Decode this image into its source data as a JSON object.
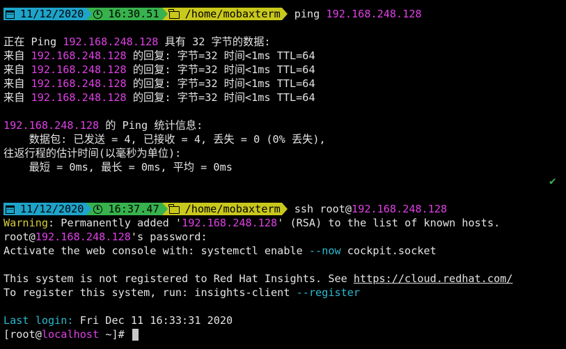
{
  "prompt1": {
    "date": "11/12/2020",
    "time": "16:30.51",
    "path": "/home/mobaxterm",
    "command": "ping ",
    "target": "192.168.248.128"
  },
  "ping": {
    "header_pre": "正在 Ping ",
    "header_ip": "192.168.248.128",
    "header_post": " 具有 32 字节的数据:",
    "replies": [
      {
        "pre": "来自 ",
        "ip": "192.168.248.128",
        "post": " 的回复: 字节=32 时间<1ms TTL=64"
      },
      {
        "pre": "来自 ",
        "ip": "192.168.248.128",
        "post": " 的回复: 字节=32 时间<1ms TTL=64"
      },
      {
        "pre": "来自 ",
        "ip": "192.168.248.128",
        "post": " 的回复: 字节=32 时间<1ms TTL=64"
      },
      {
        "pre": "来自 ",
        "ip": "192.168.248.128",
        "post": " 的回复: 字节=32 时间<1ms TTL=64"
      }
    ],
    "stats_ip": "192.168.248.128",
    "stats_title": " 的 Ping 统计信息:",
    "packets": "    数据包: 已发送 = 4, 已接收 = 4, 丢失 = 0 (0% 丢失),",
    "rtt_title": "往返行程的估计时间(以毫秒为单位):",
    "rtt": "    最短 = 0ms, 最长 = 0ms, 平均 = 0ms"
  },
  "prompt2": {
    "date": "11/12/2020",
    "time": "16:37.47",
    "path": "/home/mobaxterm",
    "command": "ssh root@",
    "target": "192.168.248.128"
  },
  "ssh": {
    "warning_label": "Warning",
    "warning_pre": ": Permanently added '",
    "warning_ip": "192.168.248.128",
    "warning_post": "' (RSA) to the list of known hosts.",
    "pw_user": "root@",
    "pw_ip": "192.168.248.128",
    "pw_post": "'s password:",
    "activate_pre": "Activate the web console with: systemctl enable ",
    "activate_flag": "--now",
    "activate_post": " cockpit.socket",
    "rh_pre": "This system is not registered to Red Hat Insights. See ",
    "rh_url": "https://cloud.redhat.com/",
    "reg_pre": "To register this system, run: insights-client ",
    "reg_flag": "--register",
    "login_label": "Last login:",
    "login_value": " Fri Dec 11 16:33:31 2020",
    "shell_open": "[root@",
    "shell_host": "localhost",
    "shell_close": " ~]# "
  },
  "status_icon": "check-icon",
  "colors": {
    "magenta": "#e040e6",
    "cyan": "#2bbad0",
    "yellow": "#d8cf3a",
    "date_bg": "#1ea3c9",
    "time_bg": "#37b24d",
    "path_bg": "#c9c81c"
  }
}
